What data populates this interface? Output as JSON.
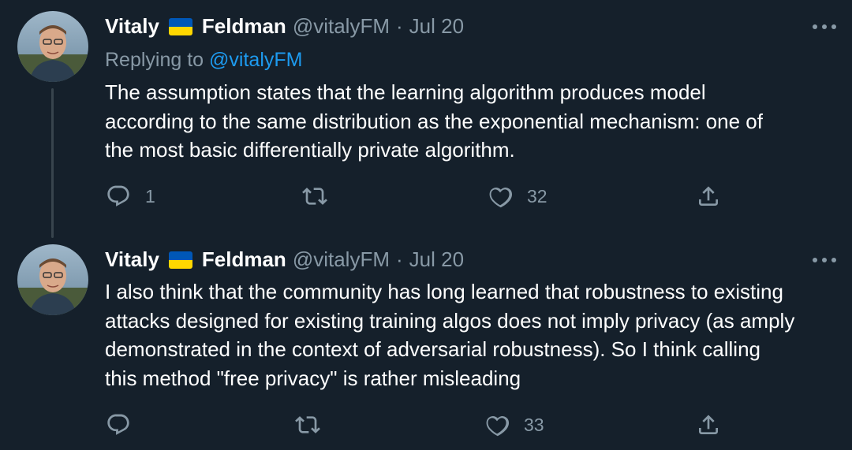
{
  "colors": {
    "background": "#15202b",
    "text": "#ffffff",
    "secondary": "#8899a6",
    "link": "#1d9bf0",
    "thread_line": "#38444d",
    "flag_blue": "#0057b7",
    "flag_yellow": "#ffd700"
  },
  "tweets": [
    {
      "author_first": "Vitaly",
      "author_flag": "ukraine-flag",
      "author_last": "Feldman",
      "handle": "@vitalyFM",
      "separator": "·",
      "date": "Jul 20",
      "replying_label": "Replying to",
      "replying_to": "@vitalyFM",
      "text_lines": [
        "The assumption states that the learning algorithm produces model",
        "according to the same distribution as the exponential mechanism: one of",
        "the most basic differentially private algorithm."
      ],
      "actions": {
        "reply_count": "1",
        "retweet_count": "",
        "like_count": "32"
      },
      "icons": [
        "reply-icon",
        "retweet-icon",
        "like-icon",
        "share-icon",
        "more-icon"
      ]
    },
    {
      "author_first": "Vitaly",
      "author_flag": "ukraine-flag",
      "author_last": "Feldman",
      "handle": "@vitalyFM",
      "separator": "·",
      "date": "Jul 20",
      "text_lines": [
        "I also think that the community has long learned that robustness to existing",
        "attacks designed for existing training algos does not imply privacy (as amply",
        "demonstrated in the context of adversarial robustness). So I think calling",
        "this method \"free privacy\" is rather misleading"
      ],
      "actions": {
        "reply_count": "",
        "retweet_count": "",
        "like_count": "33"
      },
      "icons": [
        "reply-icon",
        "retweet-icon",
        "like-icon",
        "share-icon",
        "more-icon"
      ]
    }
  ]
}
